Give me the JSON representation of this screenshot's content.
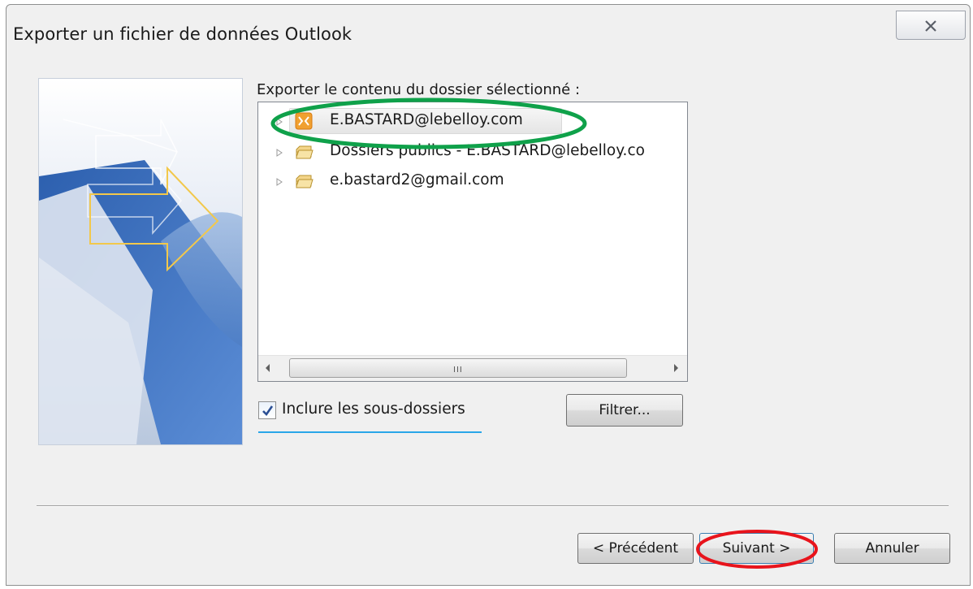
{
  "dialog": {
    "title": "Exporter un fichier de données Outlook",
    "close_icon": "close-icon"
  },
  "folder_panel": {
    "label": "Exporter le contenu du dossier sélectionné :",
    "items": [
      {
        "label": "E.BASTARD@lebelloy.com",
        "icon": "exchange-mailbox-icon",
        "selected": true
      },
      {
        "label": "Dossiers publics - E.BASTARD@lebelloy.co",
        "icon": "folder-stack-icon",
        "selected": false
      },
      {
        "label": "e.bastard2@gmail.com",
        "icon": "folder-stack-icon",
        "selected": false
      }
    ],
    "scrollbar_grip": "III"
  },
  "options": {
    "include_subfolders_label": "Inclure les sous-dossiers",
    "include_subfolders_checked": true,
    "filter_button": "Filtrer..."
  },
  "footer": {
    "back_button": "< Précédent",
    "next_button": "Suivant >",
    "cancel_button": "Annuler"
  },
  "annotations": {
    "green_ellipse_color": "#0fa14a",
    "red_ellipse_color": "#e8141c"
  }
}
